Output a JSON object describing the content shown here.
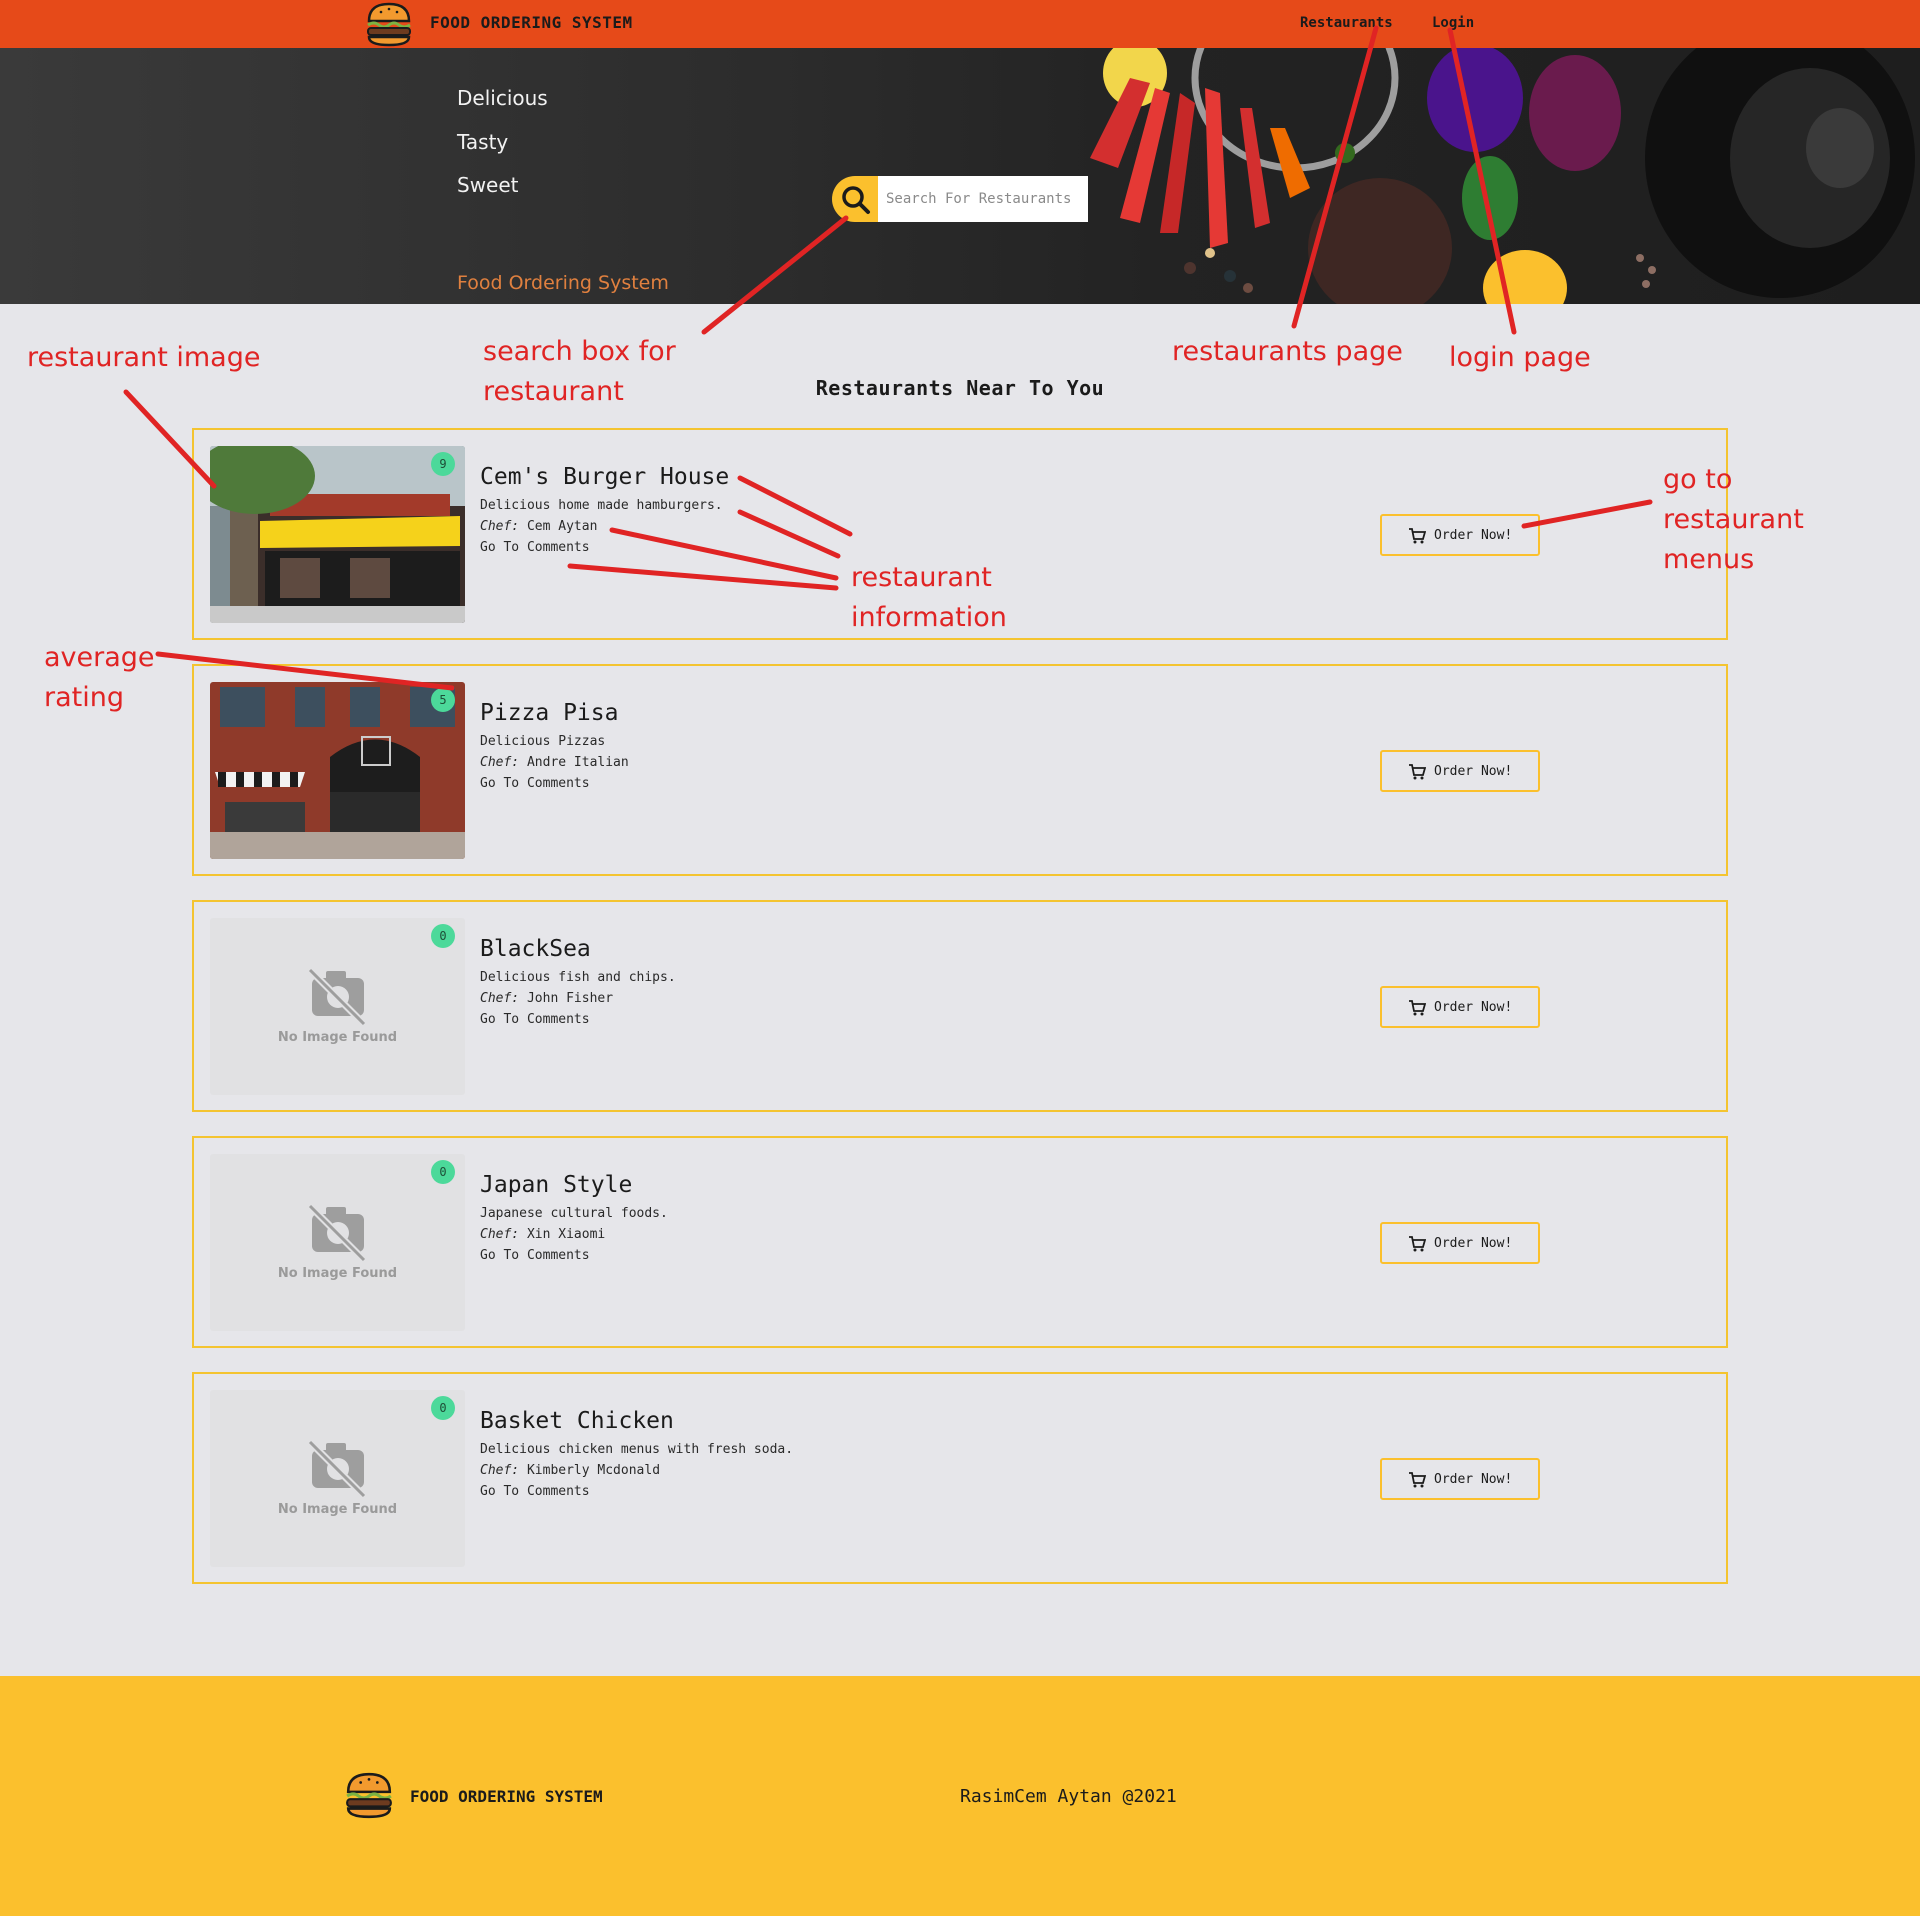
{
  "navbar": {
    "brand": "FOOD ORDERING SYSTEM",
    "links": [
      "Restaurants",
      "Login"
    ]
  },
  "hero": {
    "words": [
      "Delicious",
      "Tasty",
      "Sweet"
    ],
    "tagline": "Food Ordering System",
    "search_placeholder": "Search For Restaurants"
  },
  "section_title": "Restaurants Near To You",
  "restaurants": [
    {
      "name": "Cem's Burger House",
      "description": "Delicious home made hamburgers.",
      "chef_label": "Chef:",
      "chef": "Cem Aytan",
      "comments": "Go To Comments",
      "rating": "9",
      "image": "photo"
    },
    {
      "name": "Pizza Pisa",
      "description": "Delicious Pizzas",
      "chef_label": "Chef:",
      "chef": "Andre Italian",
      "comments": "Go To Comments",
      "rating": "5",
      "image": "photo"
    },
    {
      "name": "BlackSea",
      "description": "Delicious fish and chips.",
      "chef_label": "Chef:",
      "chef": "John Fisher",
      "comments": "Go To Comments",
      "rating": "0",
      "image": "none"
    },
    {
      "name": "Japan Style",
      "description": "Japanese cultural foods.",
      "chef_label": "Chef:",
      "chef": "Xin Xiaomi",
      "comments": "Go To Comments",
      "rating": "0",
      "image": "none"
    },
    {
      "name": "Basket Chicken",
      "description": "Delicious chicken menus with fresh soda.",
      "chef_label": "Chef:",
      "chef": "Kimberly Mcdonald",
      "comments": "Go To Comments",
      "rating": "0",
      "image": "none"
    }
  ],
  "order_button_label": "Order Now!",
  "no_image_label": "No Image Found",
  "footer": {
    "brand": "FOOD ORDERING SYSTEM",
    "copyright": "RasimCem Aytan @2021"
  },
  "annotations": {
    "restaurant_image": "restaurant image",
    "search_box_1": "search box for",
    "search_box_2": "restaurant",
    "restaurants_page": "restaurants page",
    "login_page": "login page",
    "go_to_1": "go to",
    "go_to_2": "restaurant",
    "go_to_3": "menus",
    "info_1": "restaurant",
    "info_2": "information",
    "avg_1": "average",
    "avg_2": "rating"
  },
  "colors": {
    "navbar": "#e64a19",
    "accent_yellow": "#fbc02d",
    "card_border": "#f4c430",
    "rating_badge": "#4cd99a",
    "annotation_red": "#e02424",
    "page_bg": "#e6e6ea"
  },
  "icons": [
    "burger-logo-icon",
    "search-icon",
    "cart-icon",
    "no-image-camera-icon"
  ]
}
